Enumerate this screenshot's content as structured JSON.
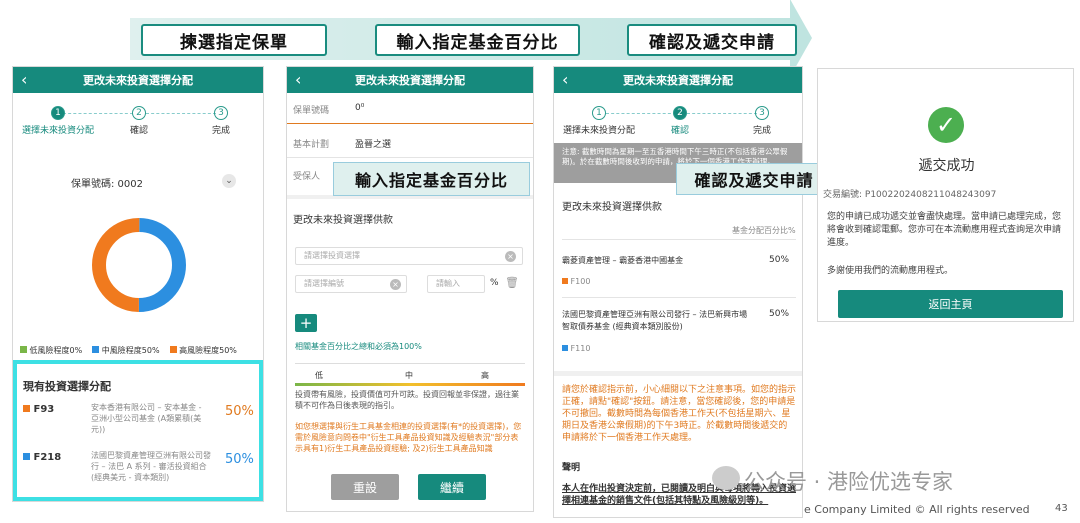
{
  "banner": {
    "step1": "揀選指定保單",
    "step2": "輸入指定基金百分比",
    "step3": "確認及遞交申請"
  },
  "screen1": {
    "title": "更改未來投資選擇分配",
    "steps": [
      "選擇未來投資分配",
      "確認",
      "完成"
    ],
    "policy_label": "保單號碼: 0002",
    "legend": [
      "低風險程度0%",
      "中風險程度50%",
      "高風險程度50%"
    ],
    "current_title": "現有投資選擇分配",
    "funds": [
      {
        "code": "F93",
        "name": "安本香港有限公司 – 安本基金 - 亞洲小型公司基金 (A類累積(美元))",
        "pct": "50%"
      },
      {
        "code": "F218",
        "name": "法國巴黎資產管理亞洲有限公司發行 – 法巴 A 系列 - 審活投資組合(經典美元 - 資本類別)",
        "pct": "50%"
      }
    ],
    "chart_data": {
      "type": "pie",
      "categories": [
        "低風險程度",
        "中風險程度",
        "高風險程度"
      ],
      "values": [
        0,
        50,
        50
      ],
      "colors": [
        "#7ab648",
        "#2c8fe0",
        "#f07a1e"
      ]
    }
  },
  "screen2": {
    "title": "更改未來投資選擇分配",
    "policy_label": "保單號碼",
    "policy_value": "0⁰",
    "plan_label": "基本計劃",
    "plan_value": "盈晉之選",
    "insured_label": "受保人",
    "section_title": "更改未來投資選擇供款",
    "select_placeholder": "請選擇投資選擇",
    "code_placeholder": "請選擇編號",
    "pct_placeholder": "請輸入",
    "pct_unit": "%",
    "add_label": "+",
    "sum_note": "相關基金百分比之總和必須為100%",
    "risk_levels": [
      "低",
      "中",
      "高"
    ],
    "risk_text": "投資帶有風險，投資價值可升可跌。投資回報並非保證，過往業積不可作為日後表現的指引。",
    "derivative_text": "如您想選擇與衍生工具基金相連的投資選擇(有*的投資選擇)，您需於風險意向問卷中\"衍生工具產品投資知識及經驗表況\"部分表示具有1)衍生工具產品投資經驗; 及2)衍生工具產品知識",
    "reset_label": "重設",
    "continue_label": "繼續",
    "callout": "輸入指定基金百分比"
  },
  "screen3": {
    "title": "更改未來投資選擇分配",
    "steps": [
      "選擇未來投資分配",
      "確認",
      "完成"
    ],
    "note": "注意: 截數時間為星期一至五香港時間下午三時正(不包括香港公眾假期)。於在截數時間後收到的申請，將於下一個香港工作天辦理。",
    "section_title": "更改未來投資選擇供款",
    "pct_header": "基金分配百分比%",
    "funds": [
      {
        "name": "霸菱資產管理 – 霸菱香港中國基金",
        "code": "F100",
        "pct": "50%",
        "color": "#f07a1e"
      },
      {
        "name": "法國巴黎資產管理亞洲有限公司發行 – 法巴新興市場智取債券基金 (經典資本類別股份)",
        "code": "F110",
        "pct": "50%",
        "color": "#2c8fe0"
      }
    ],
    "confirm_text": "請您於確認指示前，小心細閱以下之注意事項。如您的指示正確，請點\"確認\"按鈕。請注意，當您確認後，您的申請是不可撤回。截數時間為每個香港工作天(不包括星期六、星期日及香港公衆假期)的下午3時正。於截數時間後遞交的申請將於下一個香港工作天處理。",
    "declare_title": "聲明",
    "declare_text": "本人在作出投資決定前，已閱讀及明白與每項將轉入投資選擇相連基金的銷售文件(包括其特點及風險級別等)。",
    "callout": "確認及遞交申請"
  },
  "screen4": {
    "success_title": "遞交成功",
    "ref_label": "交易編號: P1002202408211048243097",
    "msg1": "您的申請已成功遞交並會盡快處理。當申請已處理完成，您將會收到確認電郵。您亦可在本流動應用程式查詢是次申請進度。",
    "msg2": "多謝使用我們的流動應用程式。",
    "home_label": "返回主頁"
  },
  "footer": {
    "watermark": "公众号 · 港险优选专家",
    "copyright": "e Company Limited © All rights reserved",
    "page": "43"
  }
}
